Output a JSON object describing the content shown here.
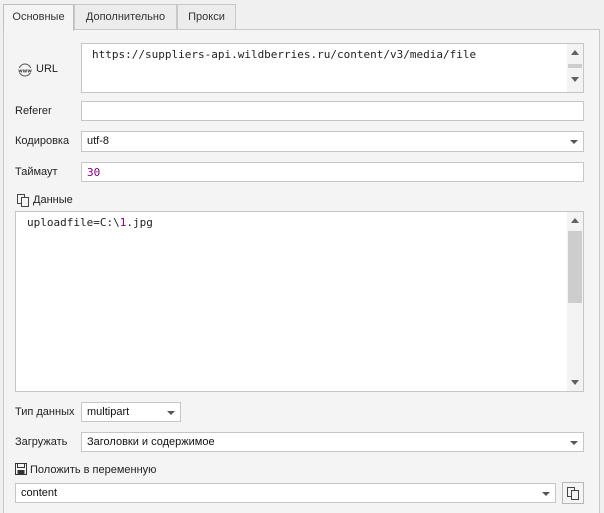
{
  "tabs": [
    {
      "label": "Основные",
      "active": true
    },
    {
      "label": "Дополнительно",
      "active": false
    },
    {
      "label": "Прокси",
      "active": false
    }
  ],
  "url": {
    "label": "URL",
    "icon": "www-globe-icon",
    "value": "https://suppliers-api.wildberries.ru/content/v3/media/file"
  },
  "referer": {
    "label": "Referer",
    "value": ""
  },
  "encoding": {
    "label": "Кодировка",
    "value": "utf-8"
  },
  "timeout": {
    "label": "Таймаут",
    "value": "30",
    "value_color": "#8b008b"
  },
  "data": {
    "label": "Данные",
    "icon": "copy-icon",
    "body_prefix": "uploadfile=C:\\",
    "body_number": "1",
    "body_suffix": ".jpg",
    "number_color": "#8b008b"
  },
  "data_type": {
    "label": "Тип данных",
    "value": "multipart"
  },
  "load": {
    "label": "Загружать",
    "value": "Заголовки и содержимое"
  },
  "save_to_var": {
    "label": "Положить в переменную",
    "icon": "save-icon",
    "value": "content"
  }
}
